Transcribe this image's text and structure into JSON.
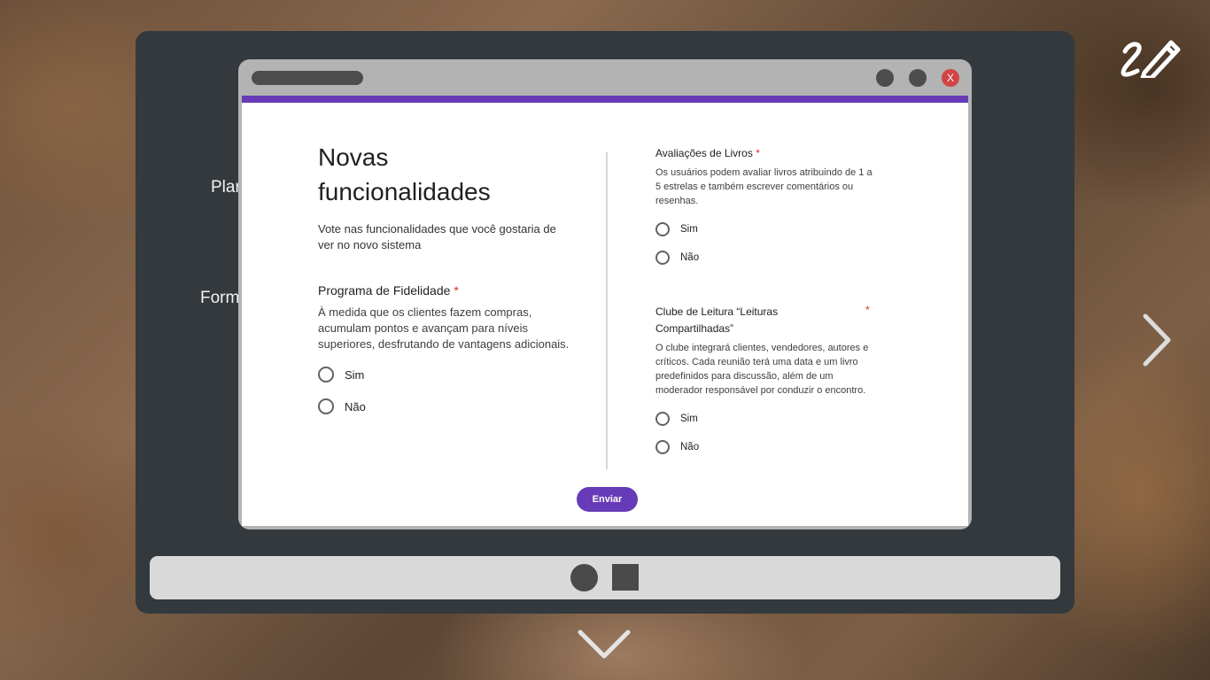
{
  "background_labels": [
    "Plar",
    "Form"
  ],
  "window": {
    "close_label": "X"
  },
  "form": {
    "title_line1": "Novas",
    "title_line2": "funcionalidades",
    "description": "Vote nas funcionalidades que você gostaria de ver no novo sistema",
    "questions": [
      {
        "title": "Programa de Fidelidade",
        "required_mark": "*",
        "description": "À medida que os clientes fazem compras, acumulam pontos e avançam para níveis superiores, desfrutando de vantagens adicionais.",
        "options": [
          "Sim",
          "Não"
        ]
      },
      {
        "title": "Avaliações de Livros",
        "required_mark": "*",
        "description": "Os usuários podem avaliar livros atribuindo de 1 a 5 estrelas e também escrever comentários ou resenhas.",
        "options": [
          "Sim",
          "Não"
        ]
      },
      {
        "title": "Clube de Leitura “Leituras Compartilhadas”",
        "required_mark": "*",
        "description": "O clube integrará clientes, vendedores, autores e críticos. Cada reunião terá uma data e um livro predefinidos para discussão, além de um moderador responsável por conduzir o encontro.",
        "options": [
          "Sim",
          "Não"
        ]
      }
    ],
    "submit_label": "Enviar"
  },
  "colors": {
    "accent": "#673ab7",
    "required": "#d93025",
    "close_button": "#d04545",
    "frame": "#33393d"
  },
  "icons": {
    "top_right": "pen-icon",
    "right": "chevron-right-icon",
    "bottom": "chevron-down-icon"
  }
}
